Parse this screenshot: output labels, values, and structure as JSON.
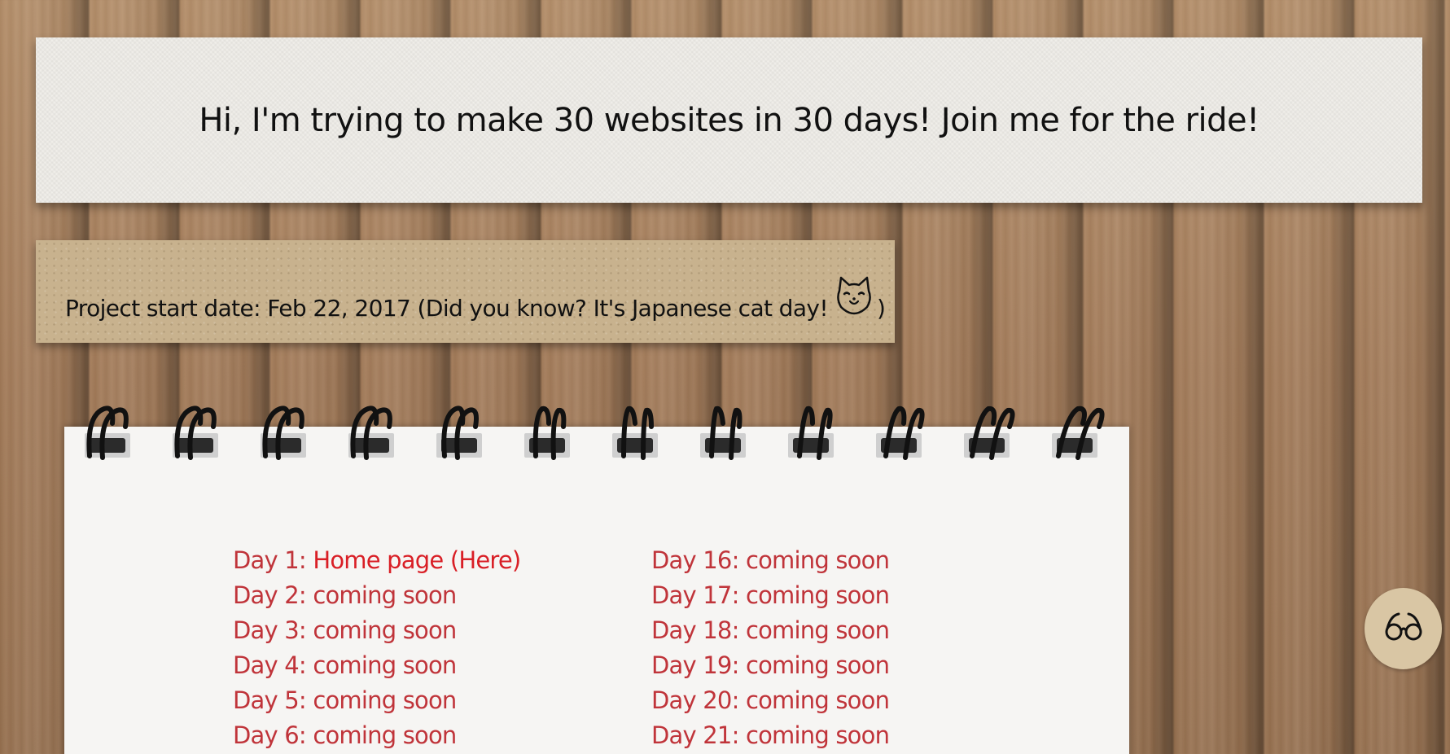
{
  "header": {
    "title": "Hi, I'm trying to make 30 websites in 30 days! Join me for the ride!"
  },
  "note": {
    "text_before": "Project start date: Feb 22, 2017 (Did you know? It's Japanese cat day!",
    "text_after": ")",
    "icon": "cat-face-icon"
  },
  "days": {
    "left": [
      {
        "prefix": "Day 1: ",
        "link": "Home page (Here)"
      },
      {
        "prefix": "Day 2: coming soon"
      },
      {
        "prefix": "Day 3: coming soon"
      },
      {
        "prefix": "Day 4: coming soon"
      },
      {
        "prefix": "Day 5: coming soon"
      },
      {
        "prefix": "Day 6: coming soon"
      }
    ],
    "right": [
      {
        "prefix": "Day 16: coming soon"
      },
      {
        "prefix": "Day 17: coming soon"
      },
      {
        "prefix": "Day 18: coming soon"
      },
      {
        "prefix": "Day 19: coming soon"
      },
      {
        "prefix": "Day 20: coming soon"
      },
      {
        "prefix": "Day 21: coming soon"
      }
    ]
  },
  "reader_button": {
    "icon": "glasses-icon"
  },
  "colors": {
    "day_text": "#c0343a",
    "link_text": "#d91f26",
    "wood": "#a27a58",
    "kraft": "#c8b28e"
  }
}
